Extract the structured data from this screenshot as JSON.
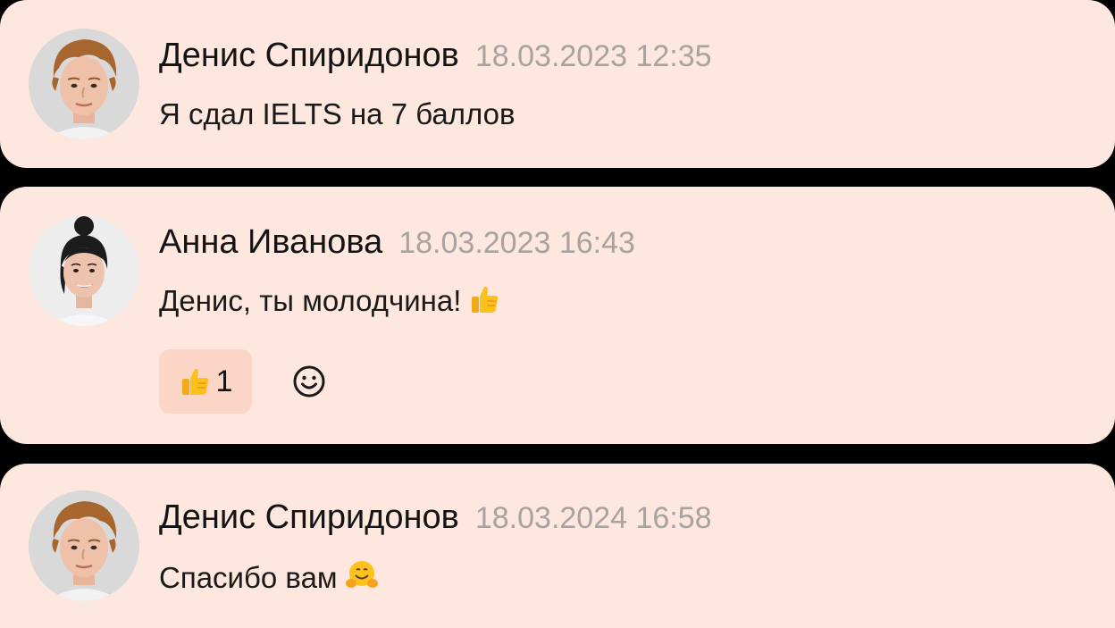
{
  "comments": [
    {
      "author": "Денис Спиридонов",
      "time": "18.03.2023 12:35",
      "text": "Я сдал IELTS на 7 баллов",
      "avatar": "man-curly-hair-avatar"
    },
    {
      "author": "Анна Иванова",
      "time": "18.03.2023 16:43",
      "text": "Денис, ты молодчина!",
      "emoji": "thumbs-up-icon",
      "avatar": "woman-bun-hair-avatar",
      "reactions": [
        {
          "emoji": "thumbs-up-icon",
          "count": "1"
        }
      ],
      "add_reaction_icon": "smiley-icon"
    },
    {
      "author": "Денис Спиридонов",
      "time": "18.03.2024 16:58",
      "text": "Спасибо вам",
      "emoji": "hugging-face-icon",
      "avatar": "man-curly-hair-avatar"
    }
  ],
  "colors": {
    "card_bg": "#fde7de",
    "reaction_bg": "#fbd6c7",
    "timestamp": "#a9a3a0",
    "text": "#141414"
  }
}
